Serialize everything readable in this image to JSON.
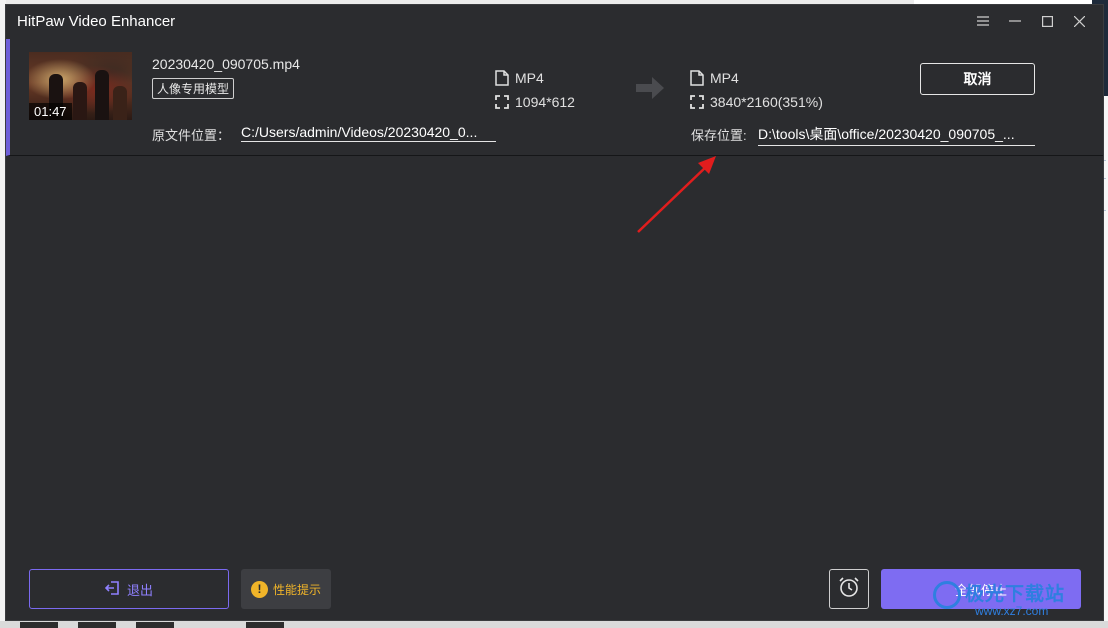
{
  "window": {
    "title": "HitPaw Video Enhancer",
    "controls": [
      "menu-icon",
      "minimize-icon",
      "maximize-icon",
      "close-icon"
    ]
  },
  "task": {
    "file_name": "20230420_090705.mp4",
    "duration": "01:47",
    "model_badge": "人像专用模型",
    "source": {
      "format": "MP4",
      "resolution": "1094*612"
    },
    "output": {
      "format": "MP4",
      "resolution": "3840*2160(351%)"
    },
    "cancel_label": "取消",
    "source_path_label": "原文件位置：",
    "source_path": "C:/Users/admin/Videos/20230420_0...",
    "save_path_label": "保存位置:",
    "save_path": "D:\\tools\\桌面\\office/20230420_090705_..."
  },
  "footer": {
    "exit_label": "退出",
    "perf_label": "性能提示",
    "stop_all_label": "全部停止"
  },
  "watermark": {
    "text": "极光下载站",
    "url": "www.xz7.com"
  },
  "colors": {
    "accent": "#7e6cf2",
    "window_bg": "#2b2c2f",
    "warning": "#f0b429",
    "annotation": "#e11d1d"
  }
}
